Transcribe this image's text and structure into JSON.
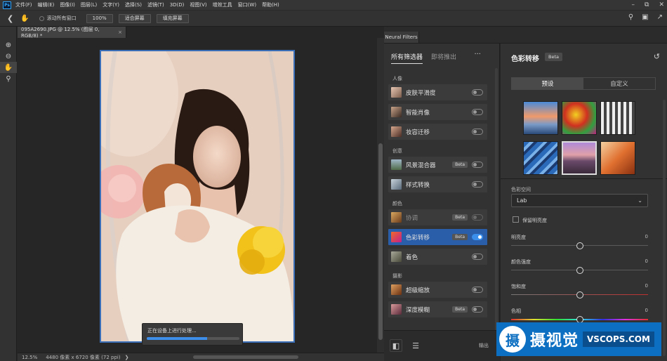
{
  "app": {
    "logo": "Ps"
  },
  "menubar": {
    "items": [
      "文件(F)",
      "编辑(E)",
      "图像(I)",
      "图层(L)",
      "文字(Y)",
      "选择(S)",
      "滤镜(T)",
      "3D(D)",
      "视图(V)",
      "增效工具",
      "窗口(W)",
      "帮助(H)"
    ]
  },
  "options": {
    "scroll_all": "滚动所有窗口",
    "zoom": "100%",
    "fit_screen": "适合屏幕",
    "fill_screen": "填充屏幕"
  },
  "document": {
    "tab_title": "095A2690.JPG @ 12.5% (图层 0, RGB/8) *",
    "close": "×"
  },
  "status": {
    "zoom": "12.5%",
    "dimensions": "4480 像素 x 6720 像素 (72 ppi)"
  },
  "progress": {
    "text": "正在设备上进行处理...",
    "fraction": 0.65
  },
  "neural_filters": {
    "panel_title": "Neural Filters",
    "tab_all": "所有筛选器",
    "tab_upcoming": "即将推出",
    "more": "···",
    "categories": [
      "人像",
      "创意",
      "颜色",
      "摄影"
    ],
    "filters": [
      {
        "label": "皮肤平滑度",
        "beta": "",
        "on": false
      },
      {
        "label": "智能肖像",
        "beta": "",
        "on": false
      },
      {
        "label": "妆容迁移",
        "beta": "",
        "on": false
      },
      {
        "label": "风景混合器",
        "beta": "Beta",
        "on": false
      },
      {
        "label": "样式转换",
        "beta": "",
        "on": false
      },
      {
        "label": "协调",
        "beta": "Beta",
        "on": false
      },
      {
        "label": "色彩转移",
        "beta": "Beta",
        "on": true
      },
      {
        "label": "着色",
        "beta": "",
        "on": false
      },
      {
        "label": "超级缩放",
        "beta": "",
        "on": false
      },
      {
        "label": "深度模糊",
        "beta": "Beta",
        "on": false
      }
    ],
    "output_label": "输出"
  },
  "settings": {
    "title": "色彩转移",
    "beta": "Beta",
    "seg_preset": "预设",
    "seg_custom": "自定义",
    "color_space_label": "色彩空间",
    "color_space_value": "Lab",
    "preserve_lum": "保留明亮度",
    "sliders": [
      {
        "label": "明亮度",
        "value": "0"
      },
      {
        "label": "颜色强度",
        "value": "0"
      },
      {
        "label": "饱和度",
        "value": "0"
      },
      {
        "label": "色相",
        "value": "0"
      }
    ]
  },
  "watermark": {
    "logo": "摄",
    "text": "摄视觉",
    "box": "VSCOPS.COM"
  },
  "colors": {
    "accent": "#2a5ea8",
    "toggle_on": "#3b8eea"
  }
}
